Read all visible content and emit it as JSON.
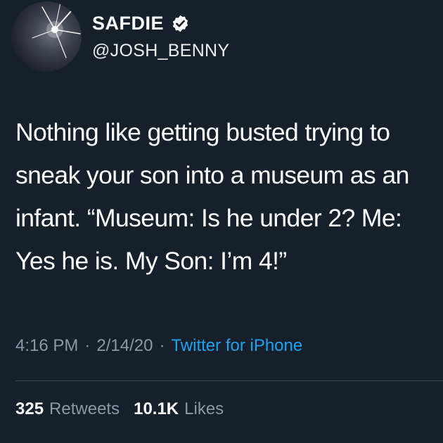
{
  "user": {
    "display_name": "SAFDIE",
    "handle": "@JOSH_BENNY",
    "verified": true
  },
  "tweet": {
    "text": "Nothing like getting busted trying to\nsneak your son into a museum as an\ninfant. “Museum: Is he under 2? Me:\nYes he is. My Son: I’m 4!”"
  },
  "meta": {
    "time": "4:16 PM",
    "separator": "·",
    "date": "2/14/20",
    "source": "Twitter for iPhone"
  },
  "stats": {
    "retweets_count": "325",
    "retweets_label": "Retweets",
    "likes_count": "10.1K",
    "likes_label": "Likes"
  },
  "colors": {
    "background": "#15202b",
    "text": "#ffffff",
    "secondary": "#8899a6",
    "accent": "#1da1f2",
    "divider": "#38444d"
  }
}
